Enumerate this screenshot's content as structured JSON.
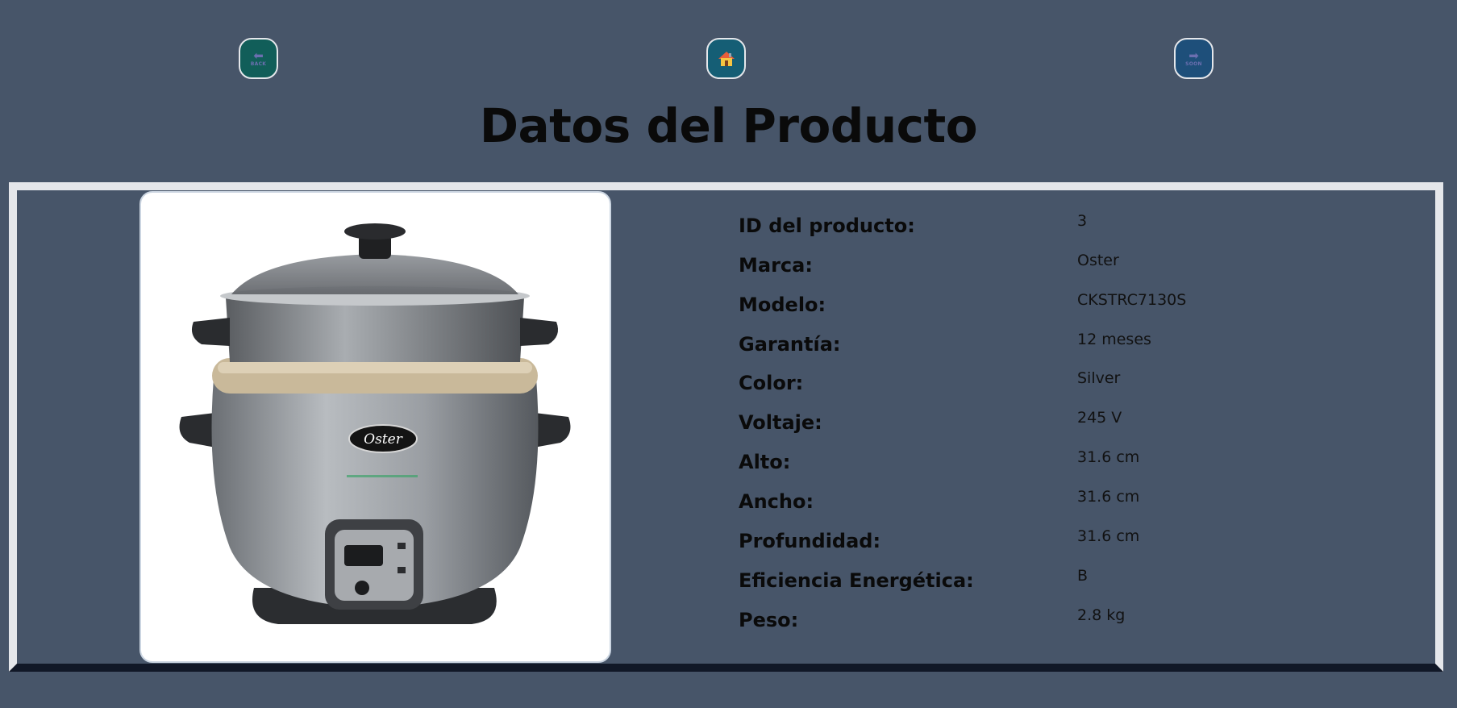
{
  "nav": {
    "back": {
      "icon": "left-arrow-icon",
      "caption": "BACK"
    },
    "home": {
      "icon": "house-icon"
    },
    "next": {
      "icon": "right-arrow-icon",
      "caption": "SOON"
    }
  },
  "page_title": "Datos del Producto",
  "product_image": {
    "brand_mark": "Oster"
  },
  "specs": [
    {
      "label": "ID del producto:",
      "value": "3"
    },
    {
      "label": "Marca:",
      "value": "Oster"
    },
    {
      "label": "Modelo:",
      "value": "CKSTRC7130S"
    },
    {
      "label": "Garantía:",
      "value": "12 meses"
    },
    {
      "label": "Color:",
      "value": "Silver"
    },
    {
      "label": "Voltaje:",
      "value": "245 V"
    },
    {
      "label": "Alto:",
      "value": "31.6 cm"
    },
    {
      "label": "Ancho:",
      "value": "31.6 cm"
    },
    {
      "label": "Profundidad:",
      "value": "31.6 cm"
    },
    {
      "label": "Eficiencia Energética:",
      "value": "B"
    },
    {
      "label": "Peso:",
      "value": "2.8 kg"
    }
  ]
}
